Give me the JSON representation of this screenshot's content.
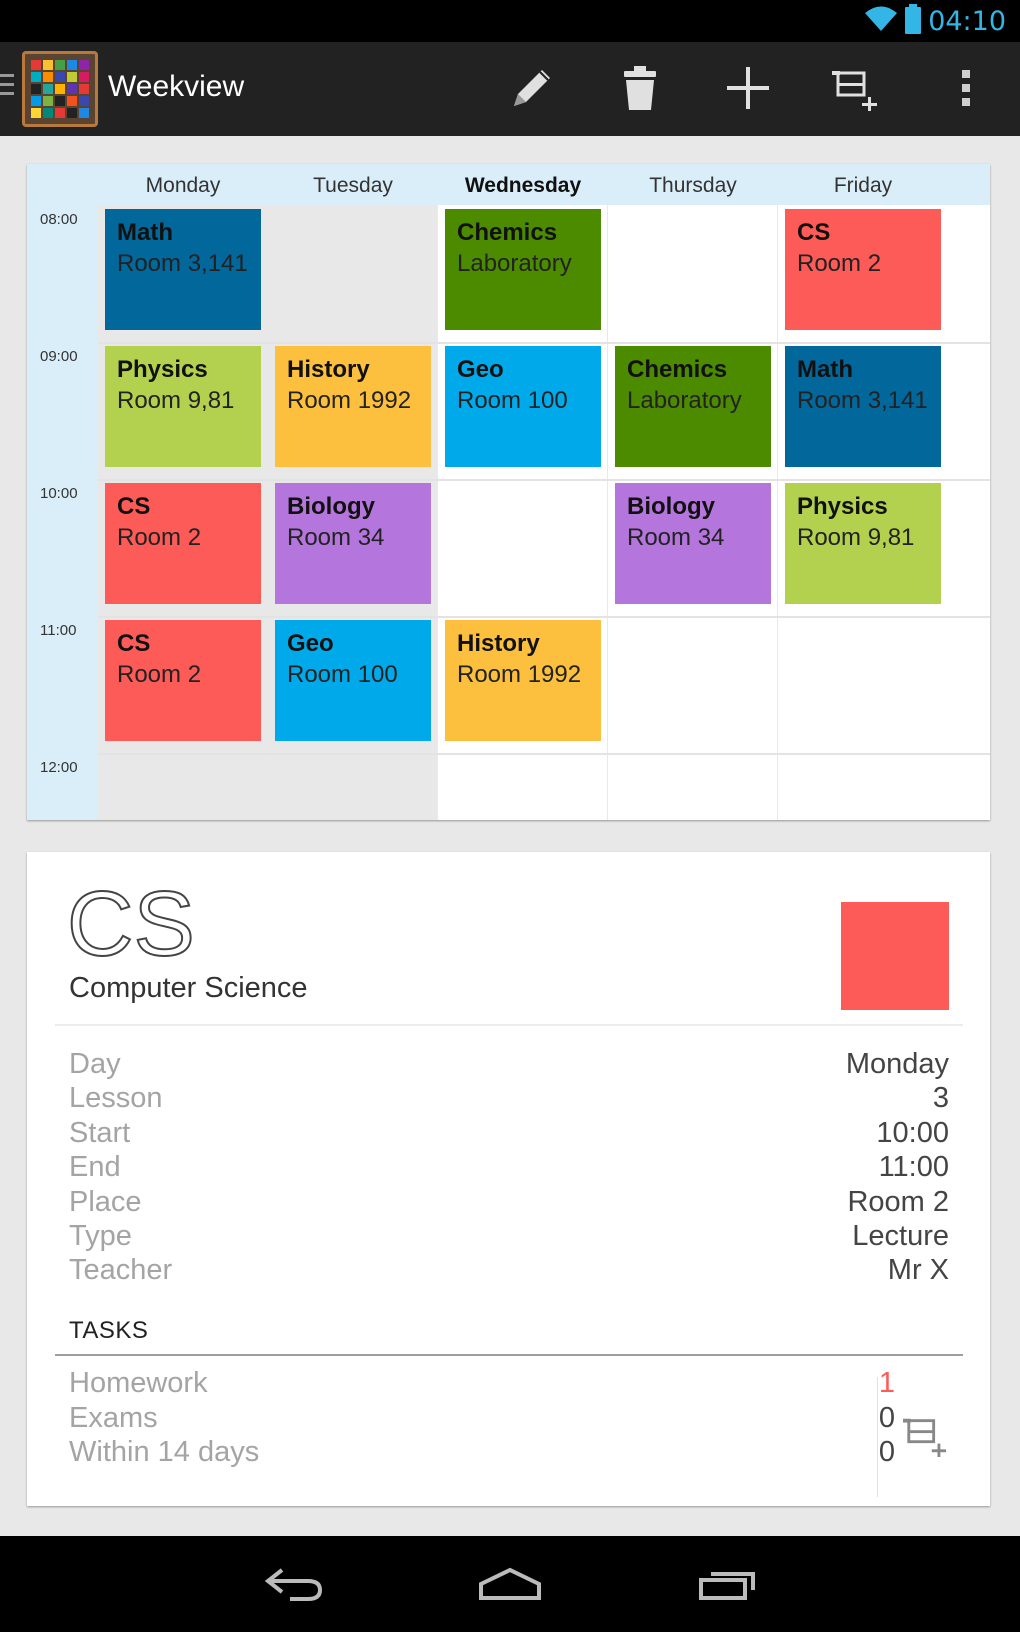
{
  "status_bar": {
    "time": "04:10",
    "icons": [
      "wifi-icon",
      "battery-icon"
    ]
  },
  "action_bar": {
    "title": "Weekview",
    "actions": [
      "edit-icon",
      "delete-icon",
      "add-icon",
      "add-task-icon",
      "overflow-menu-icon"
    ]
  },
  "timetable": {
    "days": [
      "Monday",
      "Tuesday",
      "Wednesday",
      "Thursday",
      "Friday"
    ],
    "today": "Wednesday",
    "times": [
      "08:00",
      "09:00",
      "10:00",
      "11:00",
      "12:00"
    ],
    "slots": [
      {
        "day": 0,
        "hour": 0,
        "subject": "Math",
        "room": "Room 3,141",
        "color": "#02679a"
      },
      {
        "day": 2,
        "hour": 0,
        "subject": "Chemics",
        "room": "Laboratory",
        "color": "#4c8a00"
      },
      {
        "day": 4,
        "hour": 0,
        "subject": "CS",
        "room": "Room 2",
        "color": "#fd5b58"
      },
      {
        "day": 0,
        "hour": 1,
        "subject": "Physics",
        "room": "Room 9,81",
        "color": "#b3d14e"
      },
      {
        "day": 1,
        "hour": 1,
        "subject": "History",
        "room": "Room 1992",
        "color": "#fcc03e"
      },
      {
        "day": 2,
        "hour": 1,
        "subject": "Geo",
        "room": "Room 100",
        "color": "#00aaea"
      },
      {
        "day": 3,
        "hour": 1,
        "subject": "Chemics",
        "room": "Laboratory",
        "color": "#4c8a00"
      },
      {
        "day": 4,
        "hour": 1,
        "subject": "Math",
        "room": "Room 3,141",
        "color": "#02679a"
      },
      {
        "day": 0,
        "hour": 2,
        "subject": "CS",
        "room": "Room 2",
        "color": "#fd5b58"
      },
      {
        "day": 1,
        "hour": 2,
        "subject": "Biology",
        "room": "Room 34",
        "color": "#b476dc"
      },
      {
        "day": 3,
        "hour": 2,
        "subject": "Biology",
        "room": "Room 34",
        "color": "#b476dc"
      },
      {
        "day": 4,
        "hour": 2,
        "subject": "Physics",
        "room": "Room 9,81",
        "color": "#b3d14e"
      },
      {
        "day": 0,
        "hour": 3,
        "subject": "CS",
        "room": "Room 2",
        "color": "#fd5b58"
      },
      {
        "day": 1,
        "hour": 3,
        "subject": "Geo",
        "room": "Room 100",
        "color": "#00aaea"
      },
      {
        "day": 2,
        "hour": 3,
        "subject": "History",
        "room": "Room 1992",
        "color": "#fcc03e"
      }
    ]
  },
  "detail": {
    "abbr": "CS",
    "name": "Computer Science",
    "color": "#fd5b58",
    "fields": [
      {
        "label": "Day",
        "value": "Monday"
      },
      {
        "label": "Lesson",
        "value": "3"
      },
      {
        "label": "Start",
        "value": "10:00"
      },
      {
        "label": "End",
        "value": "11:00"
      },
      {
        "label": "Place",
        "value": "Room 2"
      },
      {
        "label": "Type",
        "value": "Lecture"
      },
      {
        "label": "Teacher",
        "value": "Mr X"
      }
    ],
    "tasks_title": "TASKS",
    "tasks": [
      {
        "label": "Homework",
        "value": "1",
        "color": "#fd5b58"
      },
      {
        "label": "Exams",
        "value": "0",
        "color": "#444444"
      },
      {
        "label": "Within 14 days",
        "value": "0",
        "color": "#444444"
      }
    ]
  },
  "nav_bar": {
    "buttons": [
      "back-icon",
      "home-icon",
      "recent-apps-icon"
    ]
  },
  "colors": {
    "accent": "#33b5e5",
    "timetable_header": "#daeef9",
    "past_day_background": "#e8e8e8"
  }
}
